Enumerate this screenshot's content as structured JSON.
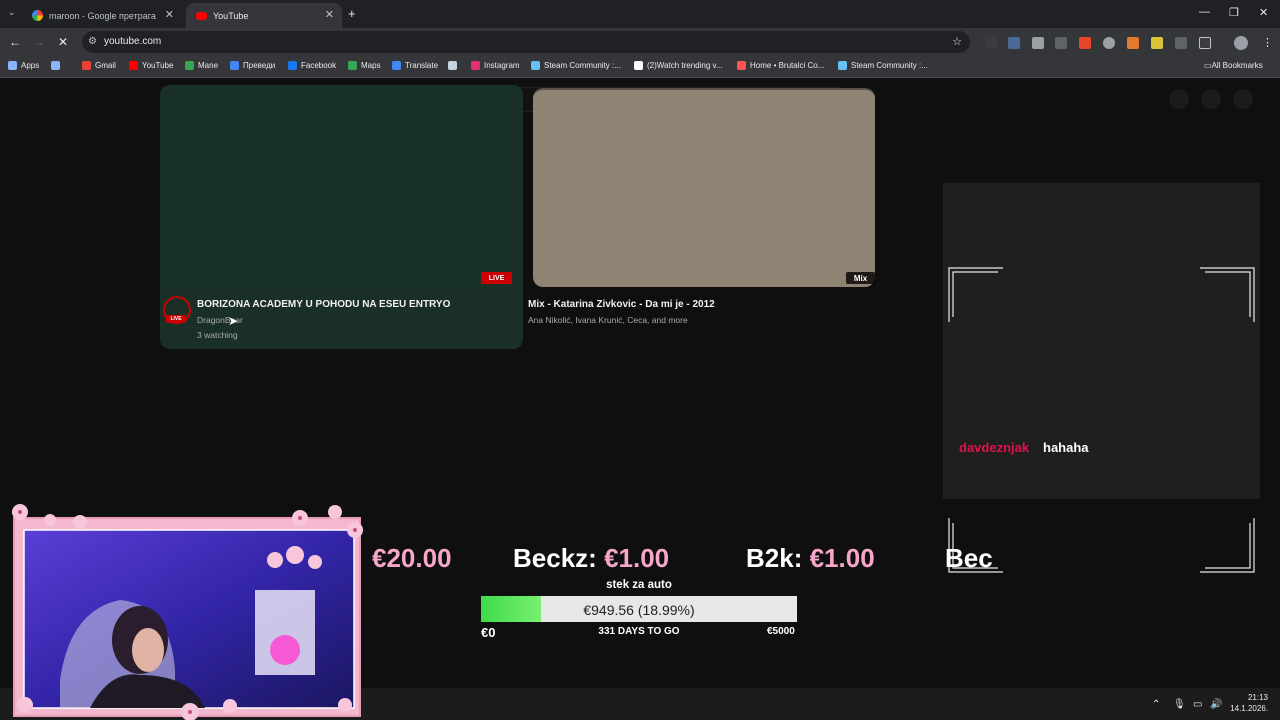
{
  "browser": {
    "tabs": [
      {
        "title": "maroon - Google претрага",
        "active": false
      },
      {
        "title": "YouTube",
        "active": true
      }
    ],
    "new_tab_label": "+",
    "window_controls": [
      "—",
      "❐",
      "✕"
    ],
    "url": "youtube.com",
    "bookmarks": [
      {
        "label": "Apps",
        "color": "#8ab4f8"
      },
      {
        "label": "",
        "color": "#8ab4f8"
      },
      {
        "label": "Gmail",
        "color": "#ea4335"
      },
      {
        "label": "YouTube",
        "color": "#ff0000"
      },
      {
        "label": "Mane",
        "color": "#34a853"
      },
      {
        "label": "Преведи",
        "color": "#4285f4"
      },
      {
        "label": "Facebook",
        "color": "#1877f2"
      },
      {
        "label": "Maps",
        "color": "#34a853"
      },
      {
        "label": "Translate",
        "color": "#4285f4"
      },
      {
        "label": "",
        "color": "#c7d5e0"
      },
      {
        "label": "Instagram",
        "color": "#e1306c"
      },
      {
        "label": "Steam Community :...",
        "color": "#66c0f4"
      },
      {
        "label": "(2)Watch trending v...",
        "color": "#ffffff"
      },
      {
        "label": "Home • Brutalci Co...",
        "color": "#ff5252"
      },
      {
        "label": "Steam Community :...",
        "color": "#66c0f4"
      }
    ],
    "all_bookmarks": "All Bookmarks"
  },
  "videos": [
    {
      "title": "BORIZONA ACADEMY U POHODU NA ESEU ENTRYO",
      "channel": "DragonBear",
      "meta": "3 watching",
      "badge": "LIVE",
      "avatar_badge": "LIVE",
      "thumb_color": "#193127"
    },
    {
      "title": "Mix - Katarina Zivkovic - Da mi je - 2012",
      "channel": "Ana Nikolić, Ivana Krunić, Ceca, and more",
      "badge": "Mix",
      "thumb_color": "#8f8373"
    }
  ],
  "chat": {
    "user": "davdeznjak",
    "message": "hahaha",
    "user_color": "#e0114c"
  },
  "ticker": [
    {
      "name": "",
      "amount": "€20.00"
    },
    {
      "name": "Beckz:",
      "amount": "€1.00"
    },
    {
      "name": "B2k:",
      "amount": "€1.00"
    },
    {
      "name": "Bec",
      "amount": ""
    }
  ],
  "goal": {
    "title": "stek za auto",
    "value_text": "€949.56 (18.99%)",
    "progress": 0.1899,
    "min_label": "€0",
    "days_label": "331 DAYS TO GO",
    "max_label": "€5000"
  },
  "taskbar": {
    "time": "21:13",
    "date": "14.1.2026."
  }
}
